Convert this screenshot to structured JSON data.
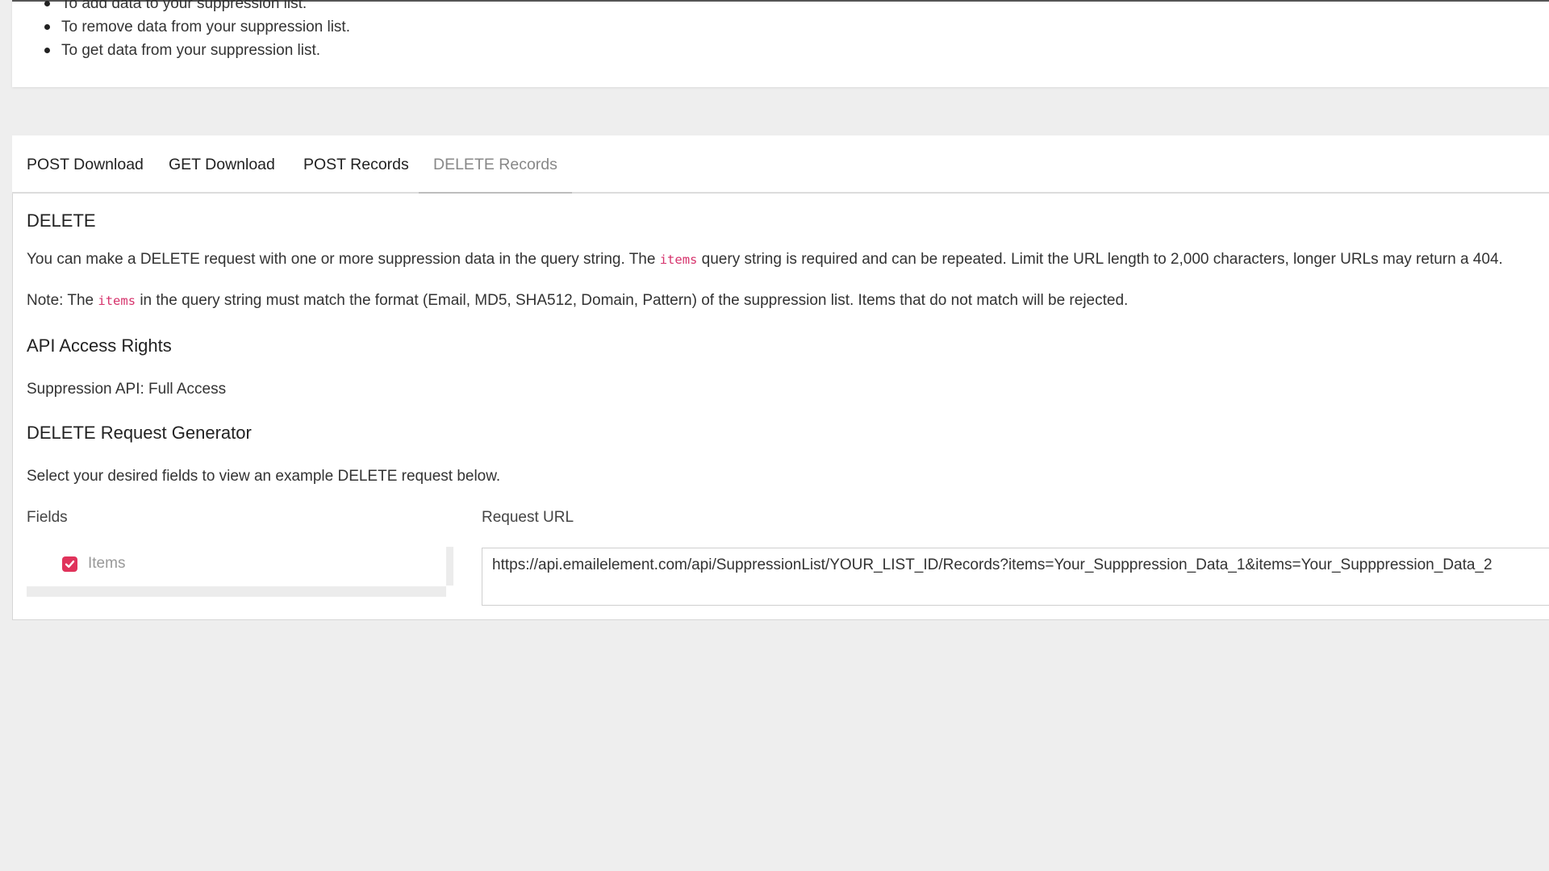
{
  "intro": {
    "partial_item": "To add data to your suppression list.",
    "items": [
      "To remove data from your suppression list.",
      "To get data from your suppression list."
    ]
  },
  "tabs": [
    {
      "label": "POST Download",
      "active": false
    },
    {
      "label": "GET Download",
      "active": false
    },
    {
      "label": "POST Records",
      "active": false
    },
    {
      "label": "DELETE Records",
      "active": true
    }
  ],
  "panel": {
    "title": "DELETE",
    "desc_pre": "You can make a DELETE request with one or more suppression data in the query string. The ",
    "desc_code": "items",
    "desc_post": " query string is required and can be repeated. Limit the URL length to 2,000 characters, longer URLs may return a 404.",
    "note_pre": "Note: The ",
    "note_code": "items",
    "note_post": " in the query string must match the format (Email, MD5, SHA512, Domain, Pattern) of the suppression list. Items that do not match will be rejected.",
    "access_title": "API Access Rights",
    "access_value": "Suppression API: Full Access",
    "generator_title": "DELETE Request Generator",
    "generator_desc": "Select your desired fields to view an example DELETE request below.",
    "fields_label": "Fields",
    "request_url_label": "Request URL",
    "fields": [
      {
        "label": "Items",
        "checked": true
      }
    ],
    "request_url": "https://api.emailelement.com/api/SuppressionList/YOUR_LIST_ID/Records?items=Your_Supppression_Data_1&items=Your_Supppression_Data_2"
  },
  "colors": {
    "accent": "#e0335b",
    "code": "#d6336c",
    "background": "#eeeeee"
  }
}
